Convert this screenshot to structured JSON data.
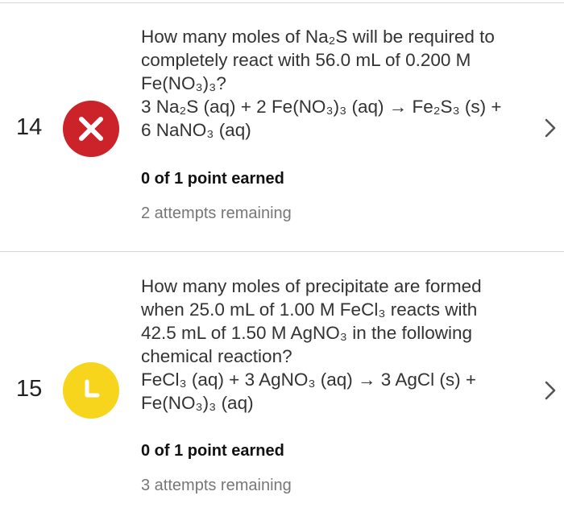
{
  "questions": [
    {
      "number": "14",
      "status": "incorrect",
      "status_icon": "close-icon",
      "status_color": "#cc2229",
      "lines": [
        "How many moles of Na₂S will be required to",
        "completely react with 56.0 mL of 0.200 M",
        "Fe(NO₃)₃?",
        "3 Na₂S (aq) + 2 Fe(NO₃)₃ (aq) → Fe₂S₃ (s) +",
        "6 NaNO₃ (aq)"
      ],
      "points": "0 of 1 point earned",
      "attempts": "2 attempts remaining"
    },
    {
      "number": "15",
      "status": "in-progress",
      "status_icon": "clock-icon",
      "status_color": "#f7d51d",
      "lines": [
        "How many moles of precipitate are formed",
        "when 25.0 mL of 1.00 M FeCl₃ reacts with",
        "42.5 mL of 1.50 M AgNO₃ in the following",
        "chemical reaction?",
        "FeCl₃ (aq) + 3 AgNO₃ (aq) → 3 AgCl (s) +",
        "Fe(NO₃)₃ (aq)"
      ],
      "points": "0 of 1 point earned",
      "attempts": "3 attempts remaining"
    }
  ],
  "row_action_icon": "chevron-right-icon"
}
